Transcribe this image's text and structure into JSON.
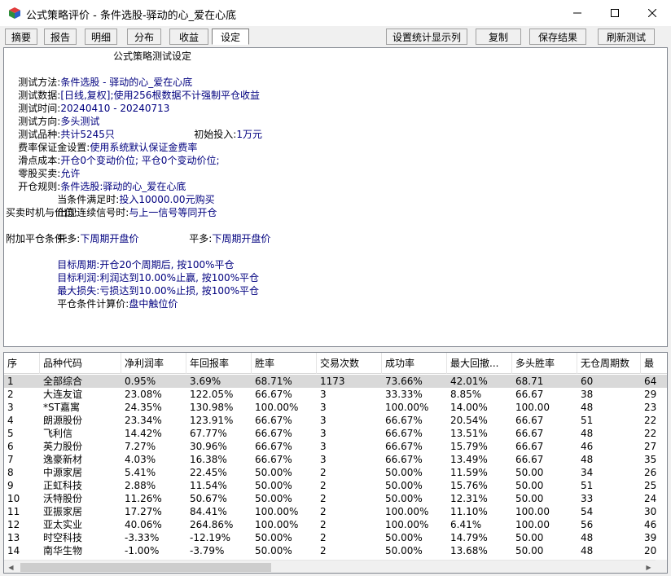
{
  "window": {
    "title": "公式策略评价 - 条件选股-驿动的心_爱在心底"
  },
  "tabs": [
    {
      "label": "摘要"
    },
    {
      "label": "报告"
    },
    {
      "label": "明细"
    },
    {
      "label": "分布"
    },
    {
      "label": "收益"
    },
    {
      "label": "设定"
    }
  ],
  "toolbar": {
    "display_columns_label": "设置统计显示列",
    "copy_label": "复制",
    "save_label": "保存结果",
    "refresh_label": "刷新测试"
  },
  "settings": {
    "heading": "公式策略测试设定",
    "method_label": "测试方法:",
    "method_value": "条件选股 - 驿动的心_爱在心底",
    "data_label": "测试数据:",
    "data_value": "[日线,复权];使用256根数据",
    "time_label": "测试时间:",
    "time_value": "20240410 - 20240713",
    "time_note": "不计强制平仓收益",
    "direction_label": "测试方向:",
    "direction_value": "多头测试",
    "variety_label": "测试品种:",
    "variety_value": "共计5245只",
    "initial_label": "初始投入:",
    "initial_value": "1万元",
    "fee_label": "费率保证金设置:",
    "fee_value": "使用系统默认保证金费率",
    "slippage_label": "滑点成本:",
    "slippage_value": "开仓0个变动价位; 平仓0个变动价位;",
    "odd_lot_label": "零股买卖:",
    "odd_lot_value": "允许",
    "open_rule_label": "开仓规则:",
    "open_rule_value": "条件选股:驿动的心_爱在心底",
    "condition_label": "当条件满足时:",
    "condition_value": "投入10000.00元购买",
    "consecutive_label": "出现连续信号时:",
    "consecutive_value": "与上一信号等同开仓",
    "timing_label": "买卖时机与价位:",
    "open_long_label": "开多:",
    "open_long_value": "下周期开盘价",
    "close_long_label": "平多:",
    "close_long_value": "下周期开盘价",
    "extra_label": "附加平仓条件:",
    "target_period_label": "目标周期:",
    "target_period_value": "开仓20个周期后, 按100%平仓",
    "target_profit_label": "目标利润:",
    "target_profit_value": "利润达到10.00%止赢, 按100%平仓",
    "max_loss_label": "最大损失:",
    "max_loss_value": "亏损达到10.00%止损, 按100%平仓",
    "close_price_label": "平仓条件计算价:",
    "close_price_value": "盘中触位价"
  },
  "table": {
    "columns": [
      "序",
      "品种代码",
      "净利润率",
      "年回报率",
      "胜率",
      "交易次数",
      "成功率",
      "最大回撤...",
      "多头胜率",
      "无仓周期数",
      "最"
    ],
    "rows": [
      [
        "1",
        "全部综合",
        "0.95%",
        "3.69%",
        "68.71%",
        "1173",
        "73.66%",
        "42.01%",
        "68.71",
        "60",
        "64"
      ],
      [
        "2",
        "大连友谊",
        "23.08%",
        "122.05%",
        "66.67%",
        "3",
        "33.33%",
        "8.85%",
        "66.67",
        "38",
        "29"
      ],
      [
        "3",
        "*ST嘉寓",
        "24.35%",
        "130.98%",
        "100.00%",
        "3",
        "100.00%",
        "14.00%",
        "100.00",
        "48",
        "23"
      ],
      [
        "4",
        "朗源股份",
        "23.34%",
        "123.91%",
        "66.67%",
        "3",
        "66.67%",
        "20.54%",
        "66.67",
        "51",
        "22"
      ],
      [
        "5",
        "飞利信",
        "14.42%",
        "67.77%",
        "66.67%",
        "3",
        "66.67%",
        "13.51%",
        "66.67",
        "48",
        "22"
      ],
      [
        "6",
        "英力股份",
        "7.27%",
        "30.96%",
        "66.67%",
        "3",
        "66.67%",
        "15.79%",
        "66.67",
        "46",
        "27"
      ],
      [
        "7",
        "逸豪新材",
        "4.03%",
        "16.38%",
        "66.67%",
        "3",
        "66.67%",
        "13.49%",
        "66.67",
        "48",
        "35"
      ],
      [
        "8",
        "中源家居",
        "5.41%",
        "22.45%",
        "50.00%",
        "2",
        "50.00%",
        "11.59%",
        "50.00",
        "34",
        "26"
      ],
      [
        "9",
        "正虹科技",
        "2.88%",
        "11.54%",
        "50.00%",
        "2",
        "50.00%",
        "15.76%",
        "50.00",
        "51",
        "25"
      ],
      [
        "10",
        "沃特股份",
        "11.26%",
        "50.67%",
        "50.00%",
        "2",
        "50.00%",
        "12.31%",
        "50.00",
        "33",
        "24"
      ],
      [
        "11",
        "亚振家居",
        "17.27%",
        "84.41%",
        "100.00%",
        "2",
        "100.00%",
        "11.10%",
        "100.00",
        "54",
        "30"
      ],
      [
        "12",
        "亚太实业",
        "40.06%",
        "264.86%",
        "100.00%",
        "2",
        "100.00%",
        "6.41%",
        "100.00",
        "56",
        "46"
      ],
      [
        "13",
        "时空科技",
        "-3.33%",
        "-12.19%",
        "50.00%",
        "2",
        "50.00%",
        "14.79%",
        "50.00",
        "48",
        "39"
      ],
      [
        "14",
        "南华生物",
        "-1.00%",
        "-3.79%",
        "50.00%",
        "2",
        "50.00%",
        "13.68%",
        "50.00",
        "48",
        "20"
      ]
    ]
  },
  "icons": {
    "app": "cube-icon",
    "minimize": "minimize-icon",
    "maximize": "maximize-icon",
    "close": "close-icon"
  },
  "colors": {
    "value_text": "#00007f",
    "selected_row": "#d9d9d9",
    "panel_border": "#828790"
  }
}
